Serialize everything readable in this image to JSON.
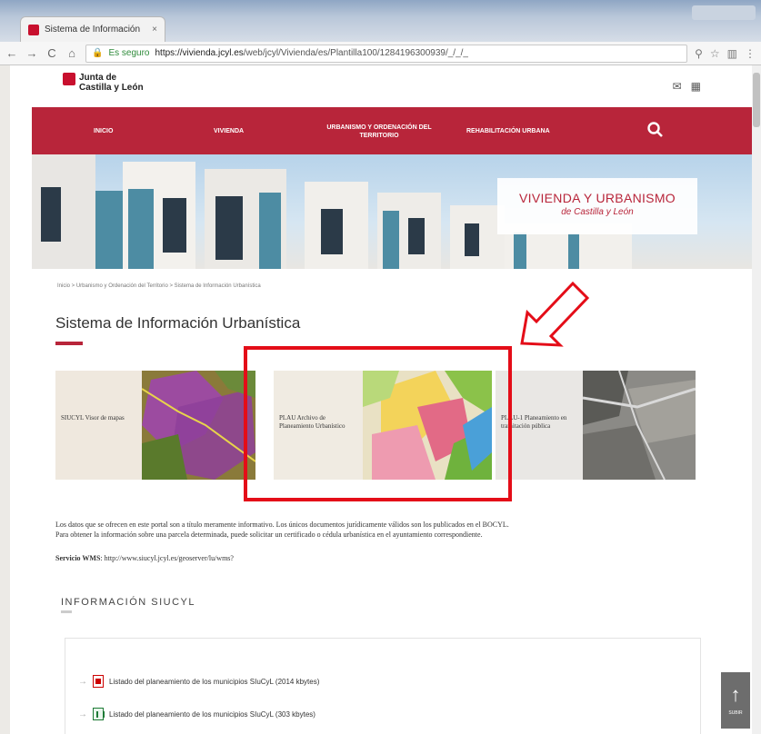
{
  "browser": {
    "tab_title": "Sistema de Información",
    "tab_close": "×",
    "secure_label": "Es seguro",
    "url_host": "https://vivienda.jcyl.es",
    "url_path": "/web/jcyl/Vivienda/es/Plantilla100/1284196300939/_/_/_"
  },
  "site": {
    "logo_line1": "Junta de",
    "logo_line2": "Castilla y León",
    "nav": [
      {
        "label": "INICIO"
      },
      {
        "label": "VIVIENDA"
      },
      {
        "label": "URBANISMO Y ORDENACIÓN DEL TERRITORIO"
      },
      {
        "label": "REHABILITACIÓN URBANA"
      }
    ],
    "hero_title": "VIVIENDA Y URBANISMO",
    "hero_sub": "de Castilla y León"
  },
  "breadcrumb": "Inicio > Urbanismo y Ordenación del Territorio > Sistema de Información Urbanística",
  "page_title": "Sistema de Información Urbanística",
  "cards": [
    {
      "label": "SIUCYL Visor de mapas"
    },
    {
      "label": "PLAU Archivo de Planeamiento Urbanístico"
    },
    {
      "label": "PLAU-1 Planeamiento en tramitación pública"
    }
  ],
  "disclaimer_line1": "Los datos que se ofrecen en este portal son a título meramente informativo. Los únicos documentos jurídicamente válidos son los publicados en el BOCYL.",
  "disclaimer_line2": "Para obtener la información sobre una parcela determinada, puede solicitar un certificado o cédula urbanística en el ayuntamiento correspondiente.",
  "wms_label": "Servicio WMS",
  "wms_value": ": http://www.siucyl.jcyl.es/geoserver/lu/wms?",
  "info_title": "INFORMACIÓN SIUCYL",
  "docs": [
    {
      "label": "Listado del planeamiento de los municipios SIuCyL (2014 kbytes)"
    },
    {
      "label": "Listado del planeamiento de los municipios SIuCyL (303 kbytes)"
    }
  ],
  "backtop_label": "SUBIR"
}
